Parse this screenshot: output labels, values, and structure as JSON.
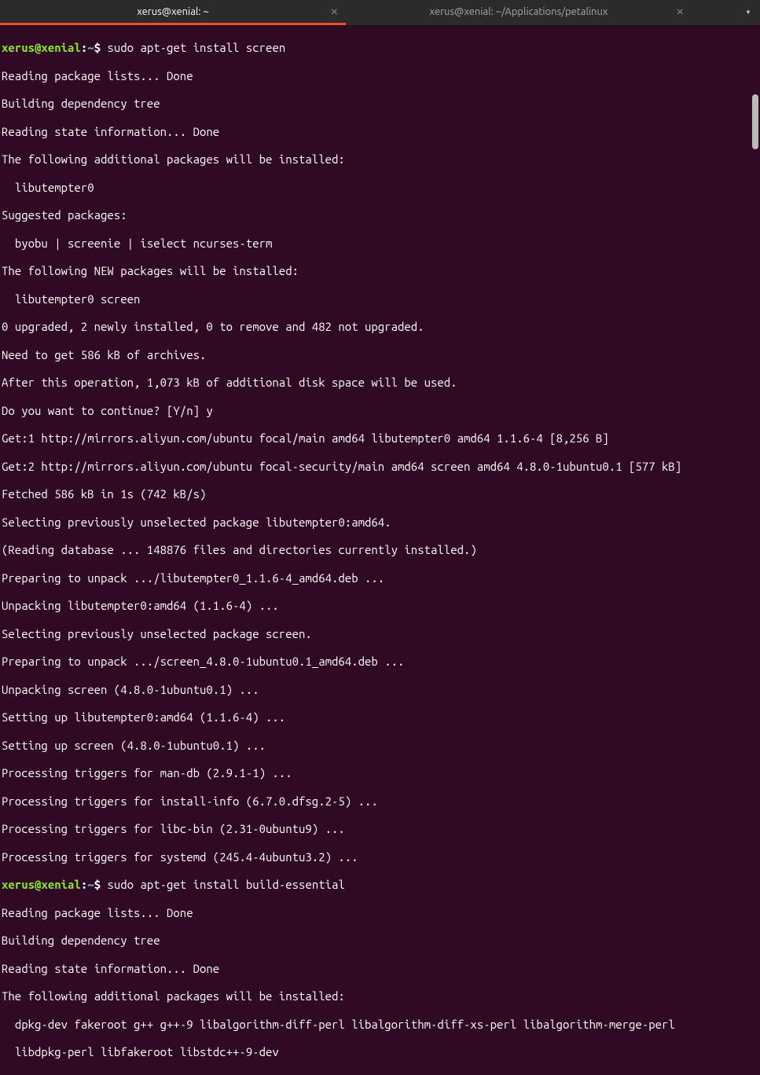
{
  "titlebar": {
    "tabs": [
      {
        "title": "xerus@xenial: ~",
        "active": true
      },
      {
        "title": "xerus@xenial: ~/Applications/petalinux",
        "active": false
      }
    ]
  },
  "prompt1": {
    "user": "xerus",
    "at": "@",
    "host": "xenial",
    "colon": ":",
    "path": "~",
    "dollar": "$ ",
    "command": "sudo apt-get install screen"
  },
  "prompt2": {
    "user": "xerus",
    "at": "@",
    "host": "xenial",
    "colon": ":",
    "path": "~",
    "dollar": "$ ",
    "command": "sudo apt-get install build-essential"
  },
  "lines": {
    "l01": "Reading package lists... Done",
    "l02": "Building dependency tree",
    "l03": "Reading state information... Done",
    "l04": "The following additional packages will be installed:",
    "l05": "  libutempter0",
    "l06": "Suggested packages:",
    "l07": "  byobu | screenie | iselect ncurses-term",
    "l08": "The following NEW packages will be installed:",
    "l09": "  libutempter0 screen",
    "l10": "0 upgraded, 2 newly installed, 0 to remove and 482 not upgraded.",
    "l11": "Need to get 586 kB of archives.",
    "l12": "After this operation, 1,073 kB of additional disk space will be used.",
    "l13": "Do you want to continue? [Y/n] y",
    "l14": "Get:1 http://mirrors.aliyun.com/ubuntu focal/main amd64 libutempter0 amd64 1.1.6-4 [8,256 B]",
    "l15": "Get:2 http://mirrors.aliyun.com/ubuntu focal-security/main amd64 screen amd64 4.8.0-1ubuntu0.1 [577 kB]",
    "l16": "Fetched 586 kB in 1s (742 kB/s)",
    "l17": "Selecting previously unselected package libutempter0:amd64.",
    "l18": "(Reading database ... 148876 files and directories currently installed.)",
    "l19": "Preparing to unpack .../libutempter0_1.1.6-4_amd64.deb ...",
    "l20": "Unpacking libutempter0:amd64 (1.1.6-4) ...",
    "l21": "Selecting previously unselected package screen.",
    "l22": "Preparing to unpack .../screen_4.8.0-1ubuntu0.1_amd64.deb ...",
    "l23": "Unpacking screen (4.8.0-1ubuntu0.1) ...",
    "l24": "Setting up libutempter0:amd64 (1.1.6-4) ...",
    "l25": "Setting up screen (4.8.0-1ubuntu0.1) ...",
    "l26": "Processing triggers for man-db (2.9.1-1) ...",
    "l27": "Processing triggers for install-info (6.7.0.dfsg.2-5) ...",
    "l28": "Processing triggers for libc-bin (2.31-0ubuntu9) ...",
    "l29": "Processing triggers for systemd (245.4-4ubuntu3.2) ...",
    "l31": "Reading package lists... Done",
    "l32": "Building dependency tree",
    "l33": "Reading state information... Done",
    "l34": "The following additional packages will be installed:",
    "l35": "  dpkg-dev fakeroot g++ g++-9 libalgorithm-diff-perl libalgorithm-diff-xs-perl libalgorithm-merge-perl",
    "l36": "  libdpkg-perl libfakeroot libstdc++-9-dev"
  }
}
